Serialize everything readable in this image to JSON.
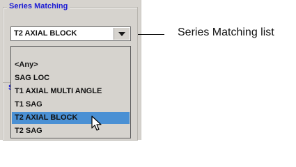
{
  "group": {
    "title": "Series Matching"
  },
  "combo": {
    "value": "T2 AXIAL BLOCK"
  },
  "dropdown": {
    "items": [
      {
        "label": "<Any>"
      },
      {
        "label": "SAG LOC"
      },
      {
        "label": "T1 AXIAL MULTI ANGLE"
      },
      {
        "label": "T1 SAG"
      },
      {
        "label": "T2 AXIAL BLOCK",
        "selected": true
      },
      {
        "label": "T2 SAG"
      }
    ]
  },
  "partial_group": {
    "letter": "S"
  },
  "callout": {
    "text": "Series Matching list"
  },
  "colors": {
    "group_title": "#1c1cd4",
    "selection": "#4a90d4",
    "panel_bg": "#d6d3ce"
  },
  "icons": {
    "combo_arrow": "chevron-down-icon",
    "pointer": "mouse-pointer-icon"
  }
}
